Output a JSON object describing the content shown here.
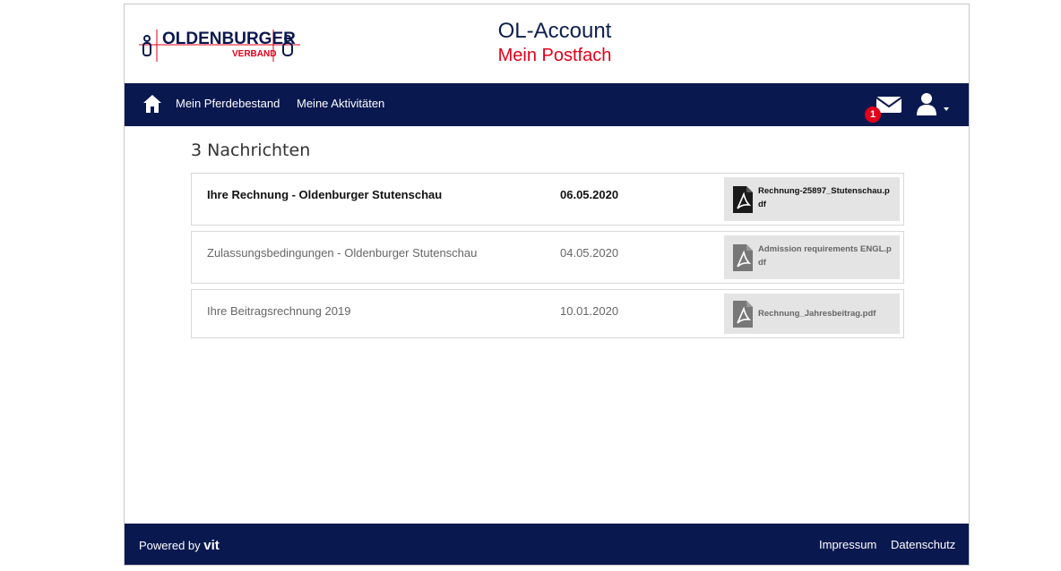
{
  "header": {
    "logo_text": "OLDENBURGER",
    "logo_subtext": "VERBAND",
    "title": "OL-Account",
    "subtitle": "Mein Postfach"
  },
  "nav": {
    "home_icon": "home-icon",
    "links": [
      "Mein Pferdebestand",
      "Meine Aktivitäten"
    ],
    "mail_badge": "1",
    "mail_icon": "envelope-icon",
    "user_icon": "user-icon"
  },
  "main": {
    "count_label": "3 Nachrichten",
    "messages": [
      {
        "subject": "Ihre Rechnung - Oldenburger Stutenschau",
        "date": "06.05.2020",
        "attachment": "Rechnung-25897_Stutenschau.pdf",
        "unread": true
      },
      {
        "subject": "Zulassungsbedingungen - Oldenburger Stutenschau",
        "date": "04.05.2020",
        "attachment": "Admission requirements ENGL.pdf",
        "unread": false
      },
      {
        "subject": "Ihre Beitragsrechnung 2019",
        "date": "10.01.2020",
        "attachment": "Rechnung_Jahresbeitrag.pdf",
        "unread": false
      }
    ]
  },
  "footer": {
    "powered_label": "Powered by",
    "vit_logo": "vit",
    "links": [
      "Impressum",
      "Datenschutz"
    ]
  },
  "colors": {
    "navy": "#0a1850",
    "red": "#e2001a"
  }
}
